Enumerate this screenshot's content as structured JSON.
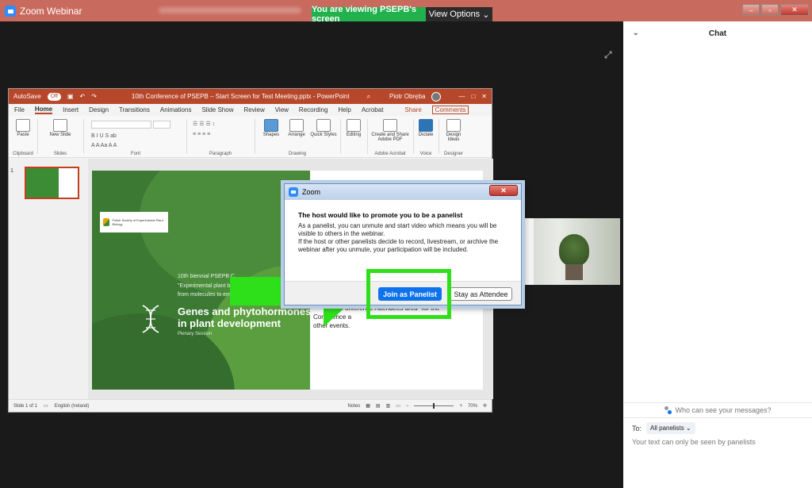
{
  "window": {
    "title": "Zoom Webinar",
    "viewing_banner": "You are viewing PSEPB's screen",
    "view_options": "View Options",
    "controls": {
      "minimize": "–",
      "maximize": "▫",
      "close": "✕"
    }
  },
  "powerpoint": {
    "autosave": "AutoSave",
    "autosave_state": "Off",
    "doc_title": "10th Conference of PSEPB – Start Screen for Test Meeting.pptx - PowerPoint",
    "user": "Piotr Obrębа",
    "tabs": [
      "File",
      "Home",
      "Insert",
      "Design",
      "Transitions",
      "Animations",
      "Slide Show",
      "Review",
      "View",
      "Recording",
      "Help",
      "Acrobat"
    ],
    "active_tab": "Home",
    "share": "Share",
    "comments": "Comments",
    "ribbon_groups": [
      "Clipboard",
      "Slides",
      "Font",
      "Paragraph",
      "Drawing",
      "Adobe Acrobat",
      "Voice",
      "Designer"
    ],
    "ribbon_labels": {
      "paste": "Paste",
      "new_slide": "New Slide",
      "shapes": "Shapes",
      "arrange": "Arrange",
      "quick_styles": "Quick Styles",
      "editing": "Editing",
      "create_share": "Create and Share Adobe PDF",
      "dictate": "Dictate",
      "design_ideas": "Design Ideas"
    },
    "slide_number": "1",
    "status_slide": "Slide 1 of 1",
    "status_language": "English (Ireland)",
    "status_notes": "Notes",
    "zoom_level": "70%"
  },
  "slide": {
    "logo_text": "Polish Society of Experimental Plant Biology",
    "line1": "10th biennial PSEPB C",
    "line2": "\"Experimental plant bi",
    "line3": "from molecules to em",
    "title": "Genes and phytohormones in plant development",
    "plenary": "Plenary Session",
    "right_line1": "onference Attendees area\" for the",
    "right_line2": "Conference a",
    "right_line3": "other events."
  },
  "dialog": {
    "title": "Zoom",
    "close": "✕",
    "heading": "The host would like to promote you to be a panelist",
    "body": "As a panelist, you can unmute and start video which means you will be visible to others in the webinar.\nIf the host or other panelists decide to record, livestream, or archive the webinar after you unmute, your participation will be included.",
    "join_button": "Join as Panelist",
    "stay_button": "Stay as Attendee"
  },
  "chat": {
    "title": "Chat",
    "who_can_see": "Who can see your messages?",
    "to_label": "To:",
    "to_value": "All panelists",
    "note": "Your text can only be seen by panelists"
  },
  "colors": {
    "title_bar": "#c96a5e",
    "banner_green": "#22b14c",
    "ppt_accent": "#b7472a",
    "zoom_blue": "#0e72ed",
    "highlight_green": "#2ee01a",
    "slide_green": "#3c7a34"
  }
}
